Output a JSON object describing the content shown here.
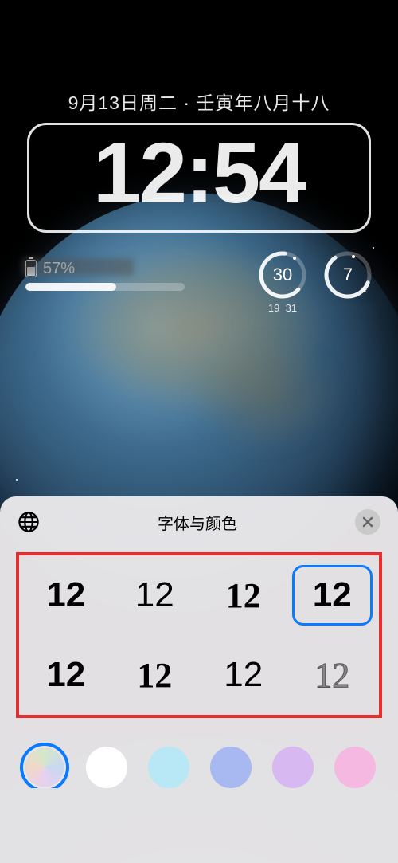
{
  "date_line": "9月13日周二 · 壬寅年八月十八",
  "clock": "12:54",
  "battery": {
    "percent_text": "57%"
  },
  "weather": {
    "current": "30",
    "low": "19",
    "high": "31"
  },
  "uv": {
    "value": "7"
  },
  "sheet": {
    "title": "字体与颜色",
    "font_sample": "12",
    "fonts": [
      "f1",
      "f2",
      "f3",
      "f4",
      "f5",
      "f6",
      "f7",
      "f8"
    ],
    "selected_font_index": 3,
    "colors": [
      {
        "css": "conic-gradient(#d4e8c8,#c8d8f0,#e8d0f0,#f0d8c8,#d4e8c8)",
        "selected": true
      },
      {
        "css": "#ffffff",
        "selected": false
      },
      {
        "css": "#b8e8f5",
        "selected": false
      },
      {
        "css": "#a8b8f0",
        "selected": false
      },
      {
        "css": "#d8b8f0",
        "selected": false
      },
      {
        "css": "#f5b8e0",
        "selected": false
      }
    ]
  }
}
